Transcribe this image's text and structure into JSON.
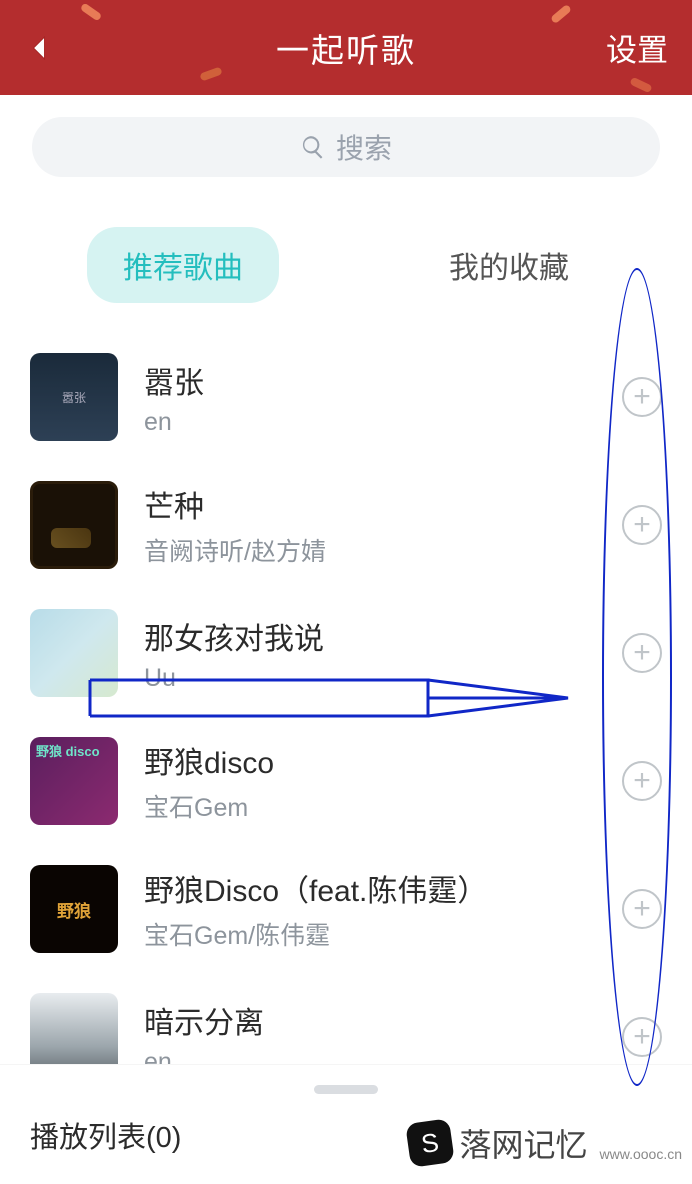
{
  "header": {
    "title": "一起听歌",
    "settings": "设置"
  },
  "search": {
    "placeholder": "搜索"
  },
  "tabs": {
    "recommended": "推荐歌曲",
    "favorites": "我的收藏"
  },
  "songs": [
    {
      "title": "嚣张",
      "artist": "en"
    },
    {
      "title": "芒种",
      "artist": "音阙诗听/赵方婧"
    },
    {
      "title": "那女孩对我说",
      "artist": "Uu"
    },
    {
      "title": "野狼disco",
      "artist": "宝石Gem"
    },
    {
      "title": "野狼Disco（feat.陈伟霆）",
      "artist": "宝石Gem/陈伟霆"
    },
    {
      "title": "暗示分离",
      "artist": "en"
    }
  ],
  "playlist": {
    "label": "播放列表(0)"
  },
  "watermark": {
    "text": "落网记忆",
    "url": "www.oooc.cn"
  },
  "cover_text": {
    "c4": "野狼 disco",
    "c5": "野狼"
  }
}
